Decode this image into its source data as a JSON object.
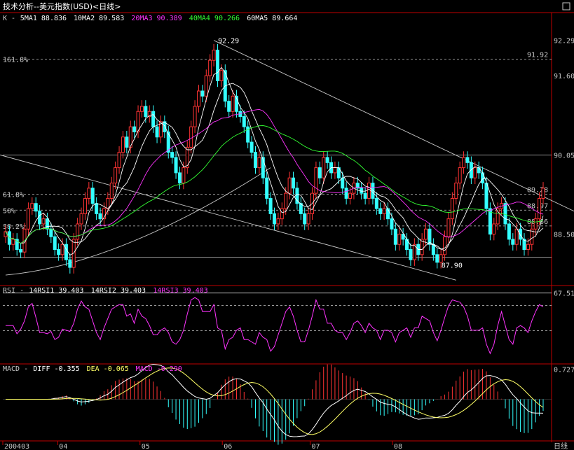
{
  "window": {
    "title": "技术分析--美元指数(USD)<日线>",
    "corner_box": "□"
  },
  "legend_price": {
    "panel": "K",
    "items": [
      {
        "label": "5MA1",
        "value": "88.836",
        "color": "#ffffff"
      },
      {
        "label": "10MA2",
        "value": "89.583",
        "color": "#ffffff"
      },
      {
        "label": "20MA3",
        "value": "90.389",
        "color": "#ff33ff"
      },
      {
        "label": "40MA4",
        "value": "90.266",
        "color": "#33ff33"
      },
      {
        "label": "60MA5",
        "value": "89.664",
        "color": "#ffffff"
      }
    ]
  },
  "legend_rsi": {
    "panel": "RSI",
    "items": [
      {
        "label": "14RSI1",
        "value": "39.403",
        "color": "#ffffff"
      },
      {
        "label": "14RSI2",
        "value": "39.403",
        "color": "#ffffff"
      },
      {
        "label": "14RSI3",
        "value": "39.403",
        "color": "#ff33ff"
      }
    ]
  },
  "legend_macd": {
    "panel": "MACD",
    "items": [
      {
        "label": "DIFF",
        "value": "-0.355",
        "color": "#ffffff"
      },
      {
        "label": "DEA",
        "value": "-0.065",
        "color": "#ffff66"
      },
      {
        "label": "MACD",
        "value": "-0.290",
        "color": "#ff33ff"
      }
    ]
  },
  "colors": {
    "up": "#ff3333",
    "down": "#33ffff",
    "axis": "#c00000",
    "grid": "#c8c8c8",
    "text": "#c8c8c8"
  },
  "chart_data": {
    "type": "candlestick",
    "instrument": "美元指数(USD)",
    "period": "日线",
    "x_tick_labels": [
      "200403",
      "04",
      "05",
      "06",
      "07",
      "08"
    ],
    "right_axis_label": "日线",
    "price_axis_ticks": [
      "92.29",
      "91.60",
      "90.05",
      "88.50"
    ],
    "price_ylim": [
      87.55,
      92.45
    ],
    "price_levels": [
      {
        "label": "161.8%",
        "value": 91.92,
        "text": "91.92",
        "style": "dashed"
      },
      {
        "label": "",
        "value": 90.05,
        "text": "",
        "style": "solid"
      },
      {
        "label": "61.8%",
        "value": 89.28,
        "text": "89.28",
        "style": "dashed"
      },
      {
        "label": "50%",
        "value": 88.97,
        "text": "88.97",
        "style": "dashed"
      },
      {
        "label": "38.2%",
        "value": 88.66,
        "text": "88.66",
        "style": "dashed"
      },
      {
        "label": "",
        "value": 88.05,
        "text": "",
        "style": "solid"
      }
    ],
    "annotations": [
      {
        "text": "92.29",
        "value": 92.29
      },
      {
        "text": "87.90",
        "value": 87.9
      }
    ],
    "rsi_axis_ticks": [
      "67.51"
    ],
    "rsi_ylim": [
      25,
      72
    ],
    "rsi_levels": [
      67.51,
      60,
      45
    ],
    "macd_axis_ticks": [
      "0.727"
    ],
    "macd_ylim": [
      -1.0,
      0.85
    ],
    "candles_close": [
      88.55,
      88.3,
      88.4,
      88.2,
      88.15,
      88.6,
      89.0,
      89.1,
      88.95,
      88.7,
      88.8,
      88.6,
      88.45,
      88.2,
      88.1,
      88.3,
      88.0,
      87.85,
      88.4,
      88.7,
      88.9,
      89.2,
      89.4,
      89.1,
      88.9,
      88.8,
      89.0,
      89.2,
      89.5,
      89.8,
      90.1,
      90.4,
      90.2,
      90.6,
      90.5,
      90.9,
      91.0,
      90.8,
      90.9,
      90.6,
      90.4,
      90.7,
      90.5,
      90.1,
      90.0,
      89.7,
      89.5,
      89.8,
      90.2,
      90.6,
      91.0,
      91.3,
      91.2,
      91.6,
      91.9,
      92.1,
      91.5,
      91.7,
      91.1,
      90.9,
      91.2,
      90.9,
      90.8,
      90.6,
      90.3,
      90.1,
      89.8,
      90.0,
      89.6,
      89.2,
      88.9,
      88.7,
      88.8,
      89.0,
      89.3,
      89.6,
      89.4,
      89.1,
      88.9,
      88.7,
      88.9,
      89.3,
      89.8,
      89.6,
      90.0,
      89.9,
      89.7,
      89.8,
      89.6,
      89.4,
      89.2,
      89.3,
      89.5,
      89.4,
      89.3,
      89.2,
      89.5,
      89.2,
      89.0,
      88.9,
      89.0,
      88.8,
      88.6,
      88.3,
      88.5,
      88.4,
      88.2,
      88.0,
      88.3,
      88.1,
      88.4,
      88.6,
      88.3,
      88.1,
      87.95,
      88.1,
      88.45,
      88.8,
      89.2,
      89.5,
      89.8,
      90.0,
      89.9,
      89.6,
      89.8,
      89.7,
      89.5,
      89.0,
      88.5,
      88.7,
      89.0,
      89.1,
      88.7,
      88.4,
      88.3,
      88.6,
      88.4,
      88.2,
      88.3,
      88.6,
      88.8,
      89.2,
      89.4
    ]
  }
}
